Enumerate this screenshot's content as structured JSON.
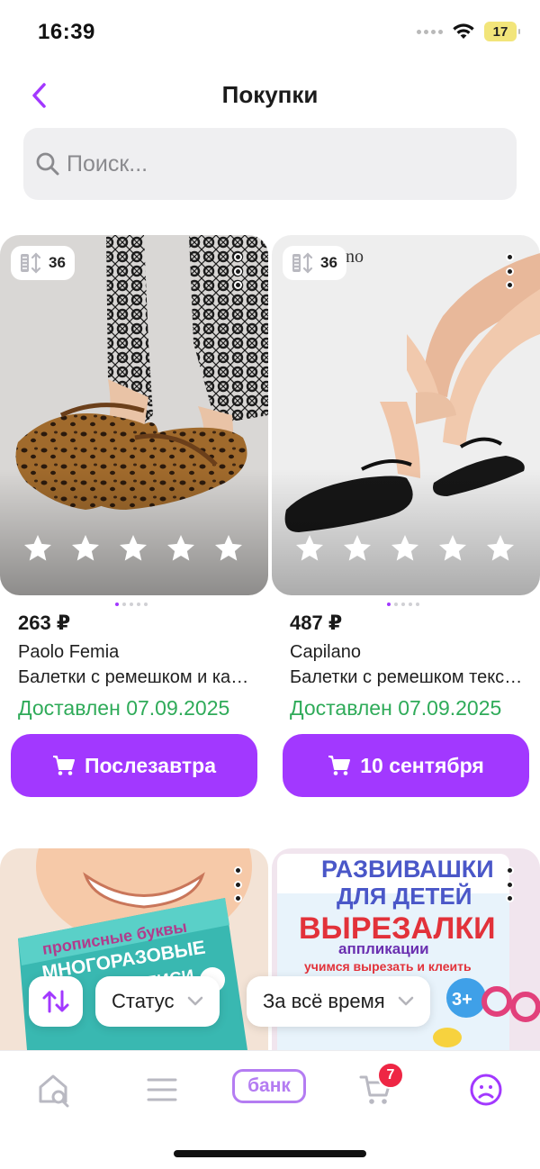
{
  "status_bar": {
    "time": "16:39",
    "battery": "17"
  },
  "header": {
    "title": "Покупки"
  },
  "search": {
    "placeholder": "Поиск..."
  },
  "products": [
    {
      "size": "36",
      "price": "263 ₽",
      "brand": "Paolo Femia",
      "name": "Балетки с ремешком и каблуком",
      "status": "Доставлен 07.09.2025",
      "button_label": "Послезавтра",
      "rating_stars": 5
    },
    {
      "size": "36",
      "price": "487 ₽",
      "brand": "Capilano",
      "name": "Балетки с ремешком текстильные",
      "status": "Доставлен 07.09.2025",
      "button_label": "10 сентября",
      "rating_stars": 5
    }
  ],
  "lower_products": [
    {
      "image_text": [
        "прописные буквы",
        "МНОГОРАЗОВЫЕ",
        "ПРОПИСИ"
      ]
    },
    {
      "image_text": [
        "РАЗВИВАШКИ",
        "ДЛЯ ДЕТЕЙ",
        "ВЫРЕЗАЛКИ",
        "аппликации",
        "учимся вырезать и клеить",
        "3+"
      ]
    }
  ],
  "image_brand_fragment": "no",
  "filters": {
    "status_label": "Статус",
    "period_label": "За всё время"
  },
  "tab_bar": {
    "bank_label": "банк",
    "cart_count": "7"
  },
  "colors": {
    "accent": "#a238ff",
    "delivered": "#2fab59",
    "badge": "#ee2644"
  }
}
